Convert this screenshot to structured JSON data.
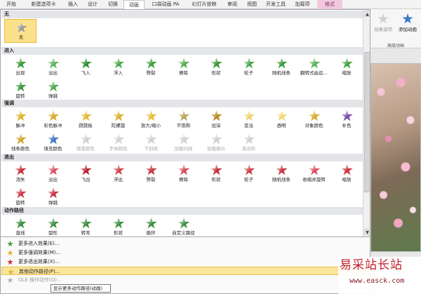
{
  "ribbon": {
    "tabs": [
      {
        "label": "开始",
        "state": "normal"
      },
      {
        "label": "新建选项卡",
        "state": "normal"
      },
      {
        "label": "插入",
        "state": "normal"
      },
      {
        "label": "设计",
        "state": "normal"
      },
      {
        "label": "切换",
        "state": "normal"
      },
      {
        "label": "动画",
        "state": "active"
      },
      {
        "label": "口袋动画 PA",
        "state": "normal"
      },
      {
        "label": "幻灯片放映",
        "state": "normal"
      },
      {
        "label": "审阅",
        "state": "normal"
      },
      {
        "label": "视图",
        "state": "normal"
      },
      {
        "label": "开发工具",
        "state": "normal"
      },
      {
        "label": "加载项",
        "state": "normal"
      },
      {
        "label": "格式",
        "state": "context"
      }
    ],
    "right_buttons": [
      {
        "label": "效果选项",
        "icon": "effect-options-icon",
        "enabled": false
      },
      {
        "label": "添加动画",
        "icon": "add-animation-icon",
        "enabled": true
      }
    ],
    "right_group_label": "高级动画"
  },
  "gallery": {
    "sections": [
      {
        "id": "none",
        "title": "无",
        "items": [
          {
            "label": "无",
            "color": "#9a9a9a",
            "selected": true,
            "enabled": true
          }
        ]
      },
      {
        "id": "entrance",
        "title": "进入",
        "items": [
          {
            "label": "出现",
            "color": "#3c9a3c",
            "enabled": true
          },
          {
            "label": "淡出",
            "color": "#59b359",
            "enabled": true
          },
          {
            "label": "飞入",
            "color": "#2f8f2f",
            "enabled": true
          },
          {
            "label": "浮入",
            "color": "#4aa84a",
            "enabled": true
          },
          {
            "label": "劈裂",
            "color": "#3f9f3f",
            "enabled": true
          },
          {
            "label": "擦除",
            "color": "#52ad52",
            "enabled": true
          },
          {
            "label": "形状",
            "color": "#3a963a",
            "enabled": true
          },
          {
            "label": "轮子",
            "color": "#48a548",
            "enabled": true
          },
          {
            "label": "随机线条",
            "color": "#3d9b3d",
            "enabled": true
          },
          {
            "label": "翻转式由远…",
            "color": "#55b055",
            "enabled": true
          },
          {
            "label": "缩放",
            "color": "#44a244",
            "enabled": true
          },
          {
            "label": "旋转",
            "color": "#3b983b",
            "enabled": true
          },
          {
            "label": "弹跳",
            "color": "#4ba94b",
            "enabled": true
          }
        ]
      },
      {
        "id": "emphasis",
        "title": "强调",
        "items": [
          {
            "label": "脉冲",
            "color": "#e0b52a",
            "enabled": true
          },
          {
            "label": "彩色脉冲",
            "color": "#d9a825",
            "enabled": true
          },
          {
            "label": "跷跷板",
            "color": "#e3b930",
            "enabled": true
          },
          {
            "label": "陀螺旋",
            "color": "#dcae28",
            "enabled": true
          },
          {
            "label": "放大/缩小",
            "color": "#e6bd33",
            "enabled": true
          },
          {
            "label": "不饱和",
            "color": "#b8a35a",
            "enabled": true
          },
          {
            "label": "加深",
            "color": "#b88a20",
            "enabled": true
          },
          {
            "label": "变淡",
            "color": "#efd36a",
            "enabled": true
          },
          {
            "label": "透明",
            "color": "#f0d778",
            "enabled": true
          },
          {
            "label": "对象颜色",
            "color": "#d8a828",
            "enabled": true
          },
          {
            "label": "补色",
            "color": "#7a4bb0",
            "enabled": true
          },
          {
            "label": "线条颜色",
            "color": "#d6a52a",
            "enabled": true
          },
          {
            "label": "填充颜色",
            "color": "#3e6fc2",
            "enabled": true
          },
          {
            "label": "画笔颜色",
            "color": "#d0d0d0",
            "enabled": false
          },
          {
            "label": "字体颜色",
            "color": "#d0d0d0",
            "enabled": false
          },
          {
            "label": "下划线",
            "color": "#d0d0d0",
            "enabled": false
          },
          {
            "label": "加粗闪烁",
            "color": "#d0d0d0",
            "enabled": false
          },
          {
            "label": "加粗展示",
            "color": "#d0d0d0",
            "enabled": false
          },
          {
            "label": "波浪形",
            "color": "#d0d0d0",
            "enabled": false
          }
        ]
      },
      {
        "id": "exit",
        "title": "退出",
        "items": [
          {
            "label": "消失",
            "color": "#c9303c",
            "enabled": true
          },
          {
            "label": "淡出",
            "color": "#d9505c",
            "enabled": true
          },
          {
            "label": "飞出",
            "color": "#b8222e",
            "enabled": true
          },
          {
            "label": "浮出",
            "color": "#cf3f4b",
            "enabled": true
          },
          {
            "label": "劈裂",
            "color": "#c23440",
            "enabled": true
          },
          {
            "label": "擦除",
            "color": "#d24854",
            "enabled": true
          },
          {
            "label": "形状",
            "color": "#c02f3b",
            "enabled": true
          },
          {
            "label": "轮子",
            "color": "#cc3a46",
            "enabled": true
          },
          {
            "label": "随机线条",
            "color": "#c63541",
            "enabled": true
          },
          {
            "label": "收缩并旋转",
            "color": "#d44c58",
            "enabled": true
          },
          {
            "label": "缩放",
            "color": "#c7323e",
            "enabled": true
          },
          {
            "label": "旋转",
            "color": "#cd3d49",
            "enabled": true
          },
          {
            "label": "弹跳",
            "color": "#c4333f",
            "enabled": true
          }
        ]
      },
      {
        "id": "motion",
        "title": "动作路径",
        "items": [
          {
            "label": "直线",
            "color": "#3c8f3c",
            "enabled": true
          },
          {
            "label": "弧形",
            "color": "#3c8f3c",
            "enabled": true
          },
          {
            "label": "转弯",
            "color": "#3c8f3c",
            "enabled": true
          },
          {
            "label": "形状",
            "color": "#3c8f3c",
            "enabled": true
          },
          {
            "label": "循环",
            "color": "#3c8f3c",
            "enabled": true
          },
          {
            "label": "自定义路径",
            "color": "#3c8f3c",
            "enabled": true
          }
        ]
      }
    ]
  },
  "menu": {
    "items": [
      {
        "label": "更多进入效果(E)...",
        "icon": "entrance-star-icon",
        "color": "#3c9a3c",
        "state": "normal"
      },
      {
        "label": "更多强调效果(M)...",
        "icon": "emphasis-star-icon",
        "color": "#e0b52a",
        "state": "normal"
      },
      {
        "label": "更多退出效果(X)...",
        "icon": "exit-star-icon",
        "color": "#c9303c",
        "state": "normal"
      },
      {
        "label": "其他动作路径(P)...",
        "icon": "motion-path-star-icon",
        "color": "#e0b52a",
        "state": "hover"
      },
      {
        "label": "OLE 操作动作(O)...",
        "icon": "ole-action-icon",
        "color": "#b0b0b0",
        "state": "disabled"
      }
    ],
    "tooltip": "显示更多动作路径(动画)"
  },
  "watermark": {
    "title": "易采站长站",
    "url": "www.easck.com"
  },
  "colors": {
    "section_header": "#e3e5e8",
    "selection": "#fbe28a",
    "hover": "#fbe59a",
    "context_tab": "#f2c8de"
  }
}
